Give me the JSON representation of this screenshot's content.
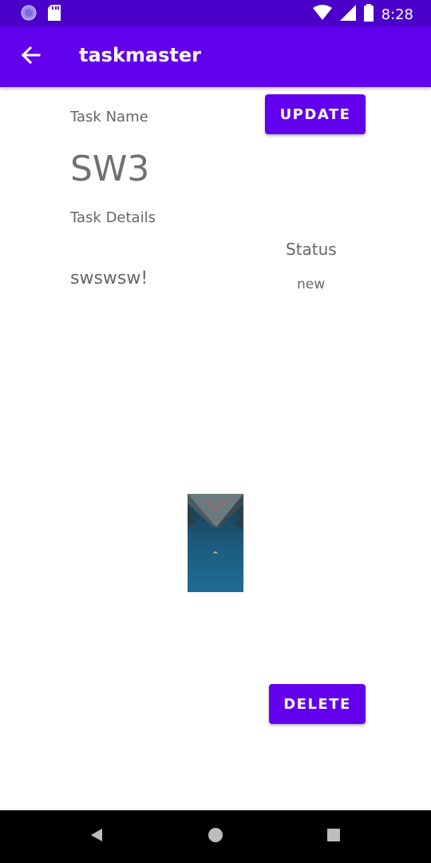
{
  "status_bar": {
    "time": "8:28",
    "left_icons": [
      "app-notification-icon",
      "sd-card-icon"
    ],
    "right_icons": [
      "wifi-icon",
      "cell-signal-icon",
      "battery-icon"
    ]
  },
  "app_bar": {
    "title": "taskmaster",
    "back_icon": "arrow-left-icon",
    "color": "#6200ee"
  },
  "task": {
    "name_label": "Task Name",
    "name": "SW3",
    "details_label": "Task Details",
    "details": "swswsw!",
    "status_label": "Status",
    "status": "new"
  },
  "buttons": {
    "update_label": "UPDATE",
    "delete_label": "DELETE"
  },
  "nav_bar": {
    "icons": [
      "back-triangle-icon",
      "home-circle-icon",
      "recents-square-icon"
    ]
  }
}
